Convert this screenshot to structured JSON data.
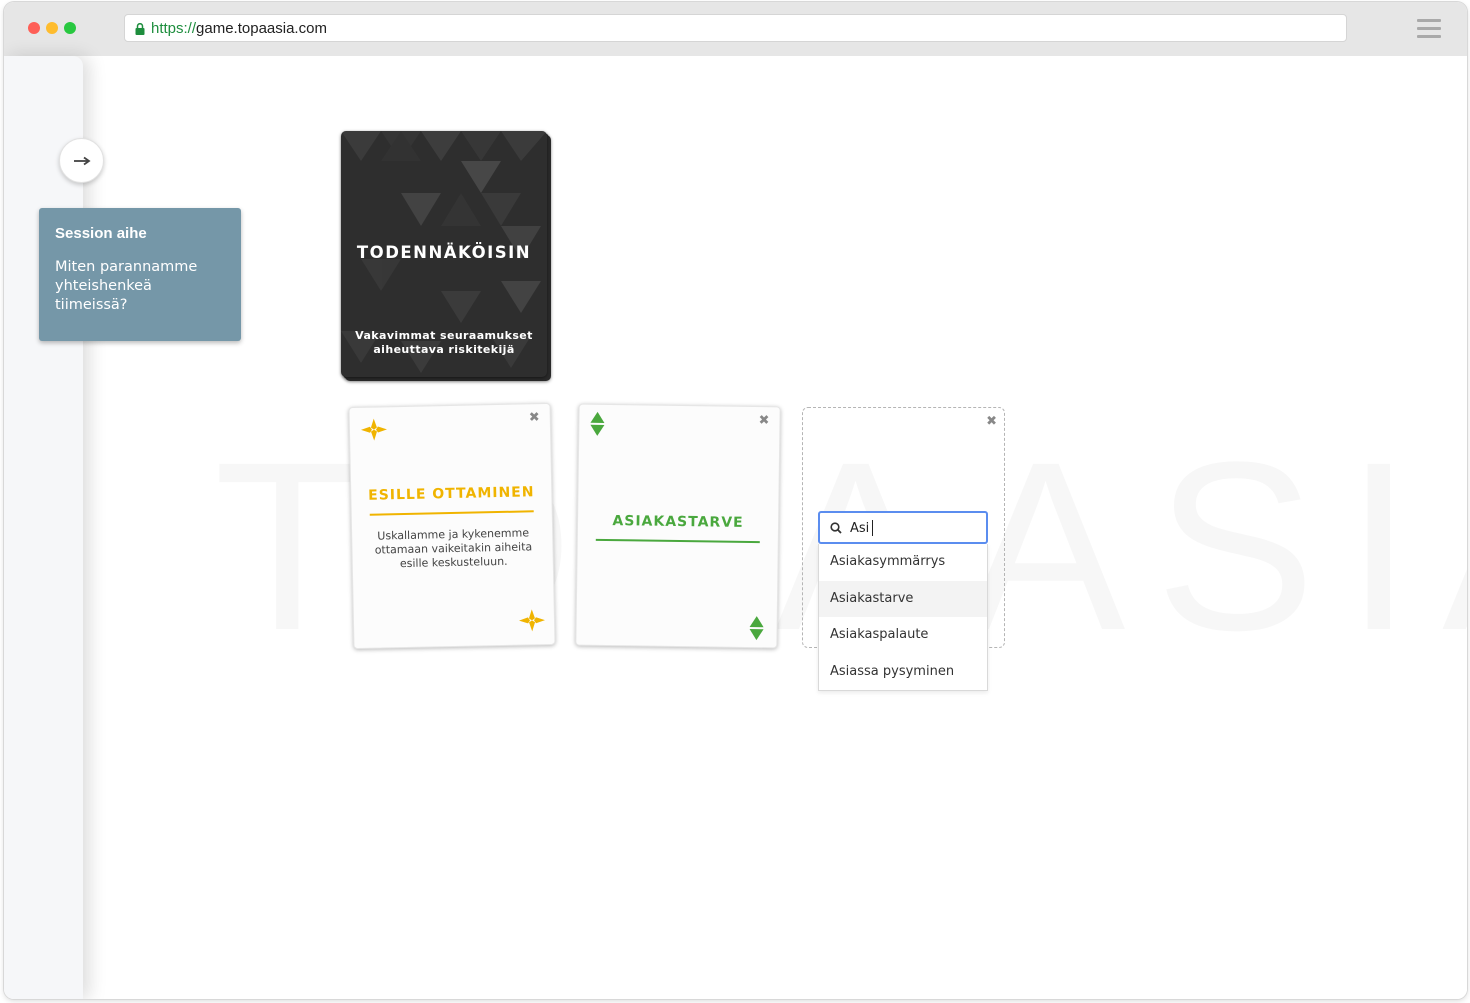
{
  "browser": {
    "url_scheme": "https://",
    "url_host": "game.topaasia.com"
  },
  "sidebar": {
    "toggle_icon": "arrow-right-icon"
  },
  "topic": {
    "title": "Session aihe",
    "text": "Miten parannamme yhteishenkeä tiimeissä?"
  },
  "watermark": {
    "text": "TOPAASIA",
    "mark": "®"
  },
  "deck": {
    "title": "TODENNÄKÖISIN",
    "subtitle": "Vakavimmat seuraamukset aiheuttava riskitekijä"
  },
  "cards": [
    {
      "title": "ESILLE OTTAMINEN",
      "description": "Uskallamme ja kykenemme ottamaan vaikeitakin aiheita esille keskusteluun.",
      "color": "#f0b400",
      "suit_icon": "yellow-star-suit-icon",
      "close": "✖"
    },
    {
      "title": "ASIAKASTARVE",
      "color": "#4aa83e",
      "suit_icon": "green-diamond-suit-icon",
      "close": "✖"
    }
  ],
  "empty_slot": {
    "close": "✖"
  },
  "search": {
    "value": "Asi",
    "options": [
      "Asiakasymmärrys",
      "Asiakastarve",
      "Asiakaspalaute",
      "Asiassa pysyminen"
    ],
    "highlighted": "Asiakastarve"
  }
}
